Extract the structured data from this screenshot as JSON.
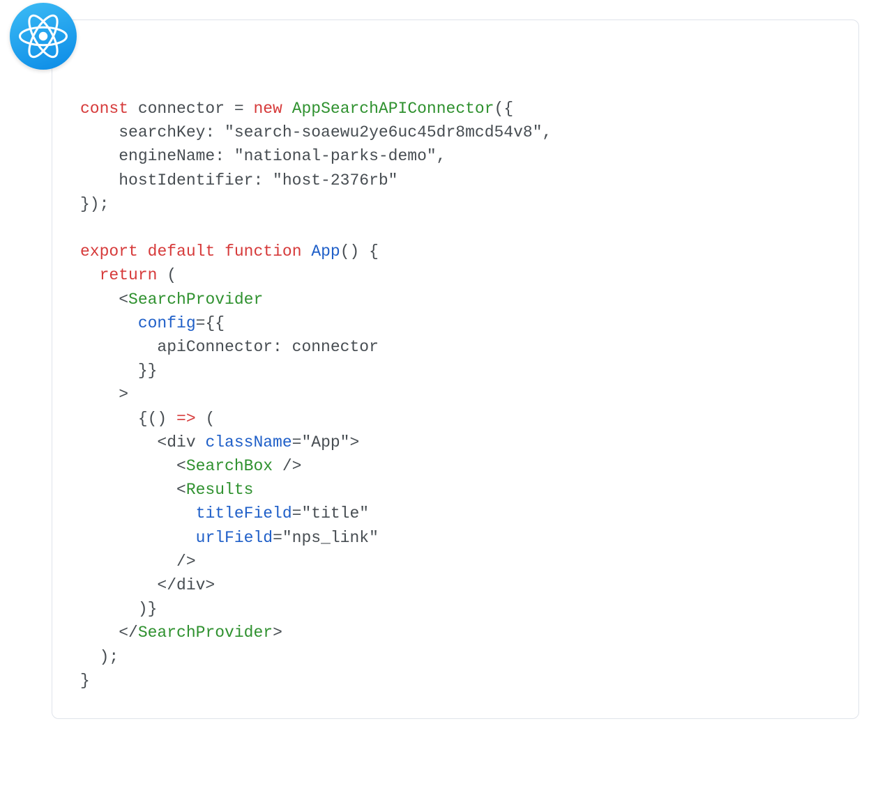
{
  "code": {
    "l1_kw_const": "const",
    "l1_id_connector": " connector ",
    "l1_eq": "= ",
    "l1_kw_new": "new",
    "l1_sp": " ",
    "l1_fn_ctor": "AppSearchAPIConnector",
    "l1_tail": "({",
    "l2_text": "    searchKey: \"search-soaewu2ye6uc45dr8mcd54v8\",",
    "l3_text": "    engineName: \"national-parks-demo\",",
    "l4_text": "    hostIdentifier: \"host-2376rb\"",
    "l5_text": "});",
    "l7_kw_export": "export",
    "l7_sp1": " ",
    "l7_kw_default": "default",
    "l7_sp2": " ",
    "l7_kw_function": "function",
    "l7_sp3": " ",
    "l7_fn_app": "App",
    "l7_tail": "() {",
    "l8_indent": "  ",
    "l8_kw_return": "return",
    "l8_tail": " (",
    "l9_indent": "    ",
    "l9_lt": "<",
    "l9_tag": "SearchProvider",
    "l10_indent": "      ",
    "l10_attr": "config",
    "l10_tail": "={{",
    "l11_text": "        apiConnector: connector",
    "l12_text": "      }}",
    "l13_text": "    >",
    "l14_indent": "      {() ",
    "l14_arrow": "=>",
    "l14_tail": " (",
    "l15_indent": "        <div ",
    "l15_attr": "className",
    "l15_tail": "=\"App\">",
    "l16_indent": "          <",
    "l16_tag": "SearchBox",
    "l16_tail": " />",
    "l17_indent": "          <",
    "l17_tag": "Results",
    "l18_indent": "            ",
    "l18_attr": "titleField",
    "l18_tail": "=\"title\"",
    "l19_indent": "            ",
    "l19_attr": "urlField",
    "l19_tail": "=\"nps_link\"",
    "l20_text": "          />",
    "l21_text": "        </div>",
    "l22_text": "      )}",
    "l23_indent": "    </",
    "l23_tag": "SearchProvider",
    "l23_tail": ">",
    "l24_text": "  );",
    "l25_text": "}"
  }
}
